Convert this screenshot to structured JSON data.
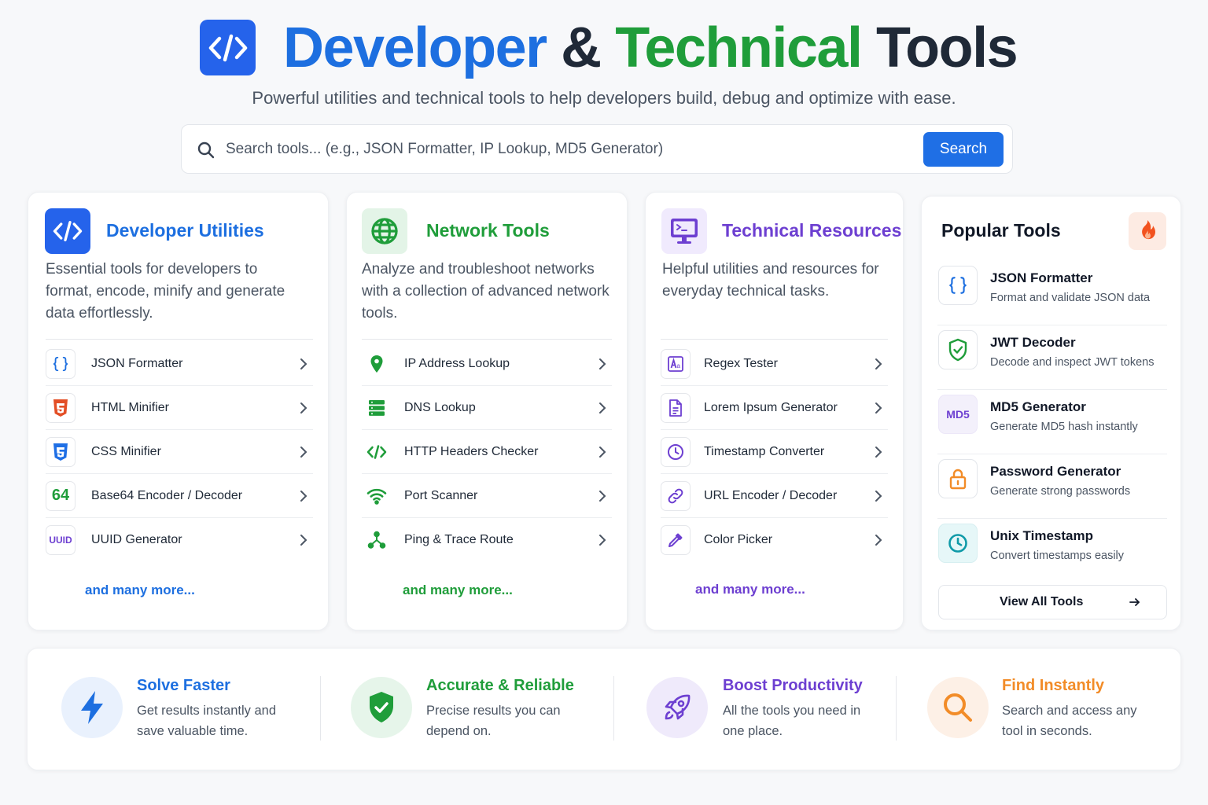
{
  "hero": {
    "title_part1": "Developer",
    "title_amp": "&",
    "title_part2": "Technical",
    "title_part3": "Tools",
    "subtitle": "Powerful utilities and technical tools to help developers build, debug and optimize with ease.",
    "logo_icon": "code-icon"
  },
  "search": {
    "placeholder": "Search tools... (e.g., JSON Formatter, IP Lookup, MD5 Generator)",
    "button_label": "Search",
    "icon": "search-icon"
  },
  "colors": {
    "blue": "#1d6fe0",
    "green": "#1f9d3a",
    "purple": "#6d3fd1",
    "orange": "#f28c28",
    "dark": "#1f2937"
  },
  "categories": [
    {
      "title": "Developer Utilities",
      "description": "Essential tools for developers to format, encode, minify and generate data effortlessly.",
      "icon": "code-icon",
      "tools": [
        {
          "label": "JSON Formatter",
          "icon": "braces-icon"
        },
        {
          "label": "HTML Minifier",
          "icon": "html5-icon"
        },
        {
          "label": "CSS Minifier",
          "icon": "css3-icon"
        },
        {
          "label": "Base64 Encoder / Decoder",
          "icon": "base64-icon"
        },
        {
          "label": "UUID Generator",
          "icon": "uuid-icon"
        }
      ],
      "more": "and many more..."
    },
    {
      "title": "Network Tools",
      "description": "Analyze and troubleshoot networks with a collection of advanced network tools.",
      "icon": "globe-icon",
      "tools": [
        {
          "label": "IP Address Lookup",
          "icon": "location-pin-icon"
        },
        {
          "label": "DNS Lookup",
          "icon": "server-icon"
        },
        {
          "label": "HTTP Headers Checker",
          "icon": "code-icon"
        },
        {
          "label": "Port Scanner",
          "icon": "wifi-icon"
        },
        {
          "label": "Ping & Trace Route",
          "icon": "network-nodes-icon"
        }
      ],
      "more": "and many more..."
    },
    {
      "title": "Technical Resources",
      "description": "Helpful utilities and resources for everyday technical tasks.",
      "icon": "terminal-monitor-icon",
      "tools": [
        {
          "label": "Regex Tester",
          "icon": "regex-icon"
        },
        {
          "label": "Lorem Ipsum Generator",
          "icon": "document-icon"
        },
        {
          "label": "Timestamp Converter",
          "icon": "clock-icon"
        },
        {
          "label": "URL Encoder / Decoder",
          "icon": "link-icon"
        },
        {
          "label": "Color Picker",
          "icon": "eyedropper-icon"
        }
      ],
      "more": "and many more..."
    }
  ],
  "popular": {
    "title": "Popular Tools",
    "icon": "fire-icon",
    "items": [
      {
        "name": "JSON Formatter",
        "desc": "Format and validate JSON data",
        "icon": "braces-icon"
      },
      {
        "name": "JWT Decoder",
        "desc": "Decode and inspect JWT tokens",
        "icon": "shield-check-icon"
      },
      {
        "name": "MD5 Generator",
        "desc": "Generate MD5 hash instantly",
        "icon": "md5-icon",
        "badge": "MD5"
      },
      {
        "name": "Password Generator",
        "desc": "Generate strong passwords",
        "icon": "lock-icon"
      },
      {
        "name": "Unix Timestamp",
        "desc": "Convert timestamps easily",
        "icon": "clock-icon"
      }
    ],
    "view_all": "View All Tools"
  },
  "tool_badges": {
    "base64": "64",
    "uuid": "UUID"
  },
  "features": [
    {
      "title": "Solve Faster",
      "desc": "Get results instantly and save valuable time.",
      "icon": "lightning-icon"
    },
    {
      "title": "Accurate & Reliable",
      "desc": "Precise results you can depend on.",
      "icon": "shield-check-icon"
    },
    {
      "title": "Boost Productivity",
      "desc": "All the tools you need in one place.",
      "icon": "rocket-icon"
    },
    {
      "title": "Find Instantly",
      "desc": "Search and access any tool in seconds.",
      "icon": "magnifier-icon"
    }
  ]
}
